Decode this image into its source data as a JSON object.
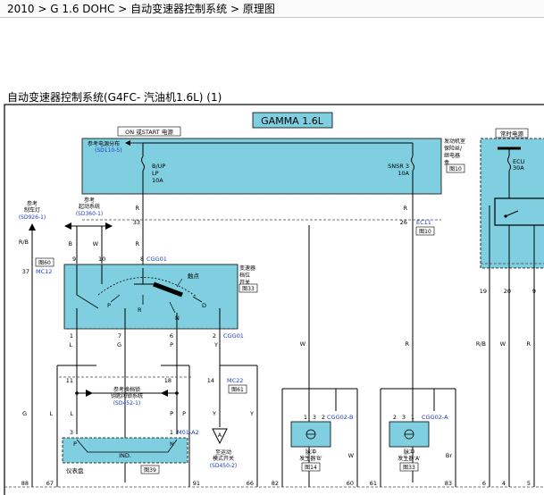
{
  "breadcrumb": {
    "item1": "2010",
    "item2": "G 1.6 DOHC",
    "item3": "自动变速器控制系统",
    "item4": "原理图",
    "sep": ">"
  },
  "doc_title": "自动变速器控制系统(G4FC- 汽油机1.6L) (1)",
  "engine_banner": "GAMMA 1.6L",
  "power_label": "ON 或START 电源",
  "constant_power_label": "常时电源",
  "fuse_box": {
    "ref_label": "参考电源分布",
    "ref_code": "(SD110-5)",
    "fuse1_name": "B/UP",
    "fuse1_code": "LP",
    "fuse1_rating": "10A",
    "fuse2_name": "SNSR 3",
    "fuse2_rating": "10A",
    "side_label_1": "发动机室",
    "side_label_2": "保险丝/",
    "side_label_3": "继电器",
    "side_label_4": "盒",
    "side_ref": "图10"
  },
  "ecu_fuse": {
    "name": "ECU",
    "rating": "30A"
  },
  "left_refs": {
    "brake_1": "参考",
    "brake_2": "制车灯",
    "brake_code": "(SD926-1)",
    "start_1": "参考",
    "start_2": "起动系统",
    "start_code": "(SD360-1)"
  },
  "wires": {
    "rb": "R/B",
    "b": "B",
    "w": "W",
    "r": "R",
    "l": "L",
    "g": "G",
    "p": "P",
    "y": "Y",
    "br": "Br"
  },
  "pins": {
    "p37": "37",
    "p9": "9",
    "p10": "10",
    "p8": "8",
    "p33": "33",
    "p26": "26",
    "p1": "1",
    "p7": "7",
    "p6": "6",
    "p2": "2",
    "p11": "11",
    "p18": "18",
    "p14": "14",
    "p3": "3",
    "p19": "19",
    "p20": "20",
    "p9b": "9",
    "p88": "88",
    "p67": "67",
    "p91": "91",
    "p66": "66",
    "p82": "82",
    "p60": "60",
    "p61": "61",
    "p83": "83",
    "p6b": "6",
    "p4": "4",
    "p5": "5"
  },
  "connectors": {
    "mc12": "MC12",
    "fig60": "图60",
    "cgg01": "CGG01",
    "cgg01b": "CGG01",
    "ec11": "EC11",
    "fig10": "图10",
    "mc22": "MC22",
    "fig61": "图61",
    "m01a2": "M01-A2",
    "cgg02b": "CGG02-B",
    "cgg02a": "CGG02-A"
  },
  "inhibitor_switch": {
    "name_1": "变速器",
    "name_2": "档位",
    "name_3": "开关",
    "ref": "图33",
    "contact": "触点",
    "pos_p": "P",
    "pos_r": "R",
    "pos_n": "N",
    "pos_d": "D"
  },
  "shift_lock": {
    "line1": "参考换档锁",
    "line2": "钥匙闭锁系统",
    "code": "(SD452-1)"
  },
  "cluster": {
    "name": "仪表盘",
    "ind": "IND.",
    "ref": "图39",
    "pin_p": "P",
    "pin_n": "N"
  },
  "sport_mode": {
    "letter": "A",
    "line1": "至运动",
    "line2": "模式开关",
    "code": "(SD450-2)"
  },
  "pulse_gen_b": {
    "name_1": "脉冲",
    "name_2": "发生器'B'",
    "ref": "图14"
  },
  "pulse_gen_a": {
    "name_1": "脉冲",
    "name_2": "发生器'A'",
    "ref": "图33"
  },
  "colors": {
    "cyan_fill": "#7fcfe0",
    "blue_text": "#1a3cc8",
    "dash": "#444444"
  }
}
